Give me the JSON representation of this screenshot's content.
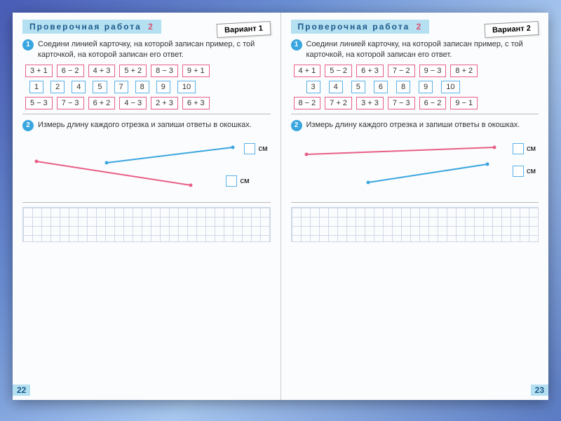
{
  "left": {
    "title": "Проверочная  работа",
    "title_num": "2",
    "variant": "Вариант 1",
    "task1_num": "1",
    "task1_text": "Соедини линией карточку, на которой записан пример, с той карточкой, на которой записан его ответ.",
    "row1": [
      "3 + 1",
      "6 − 2",
      "4 + 3",
      "5 + 2",
      "8 − 3",
      "9 + 1"
    ],
    "row2": [
      "1",
      "2",
      "4",
      "5",
      "7",
      "8",
      "9",
      "10"
    ],
    "row3": [
      "5 − 3",
      "7 − 3",
      "6 + 2",
      "4 − 3",
      "2 + 3",
      "6 + 3"
    ],
    "task2_num": "2",
    "task2_text": "Измерь длину каждого отрезка и запиши ответы в окошках.",
    "cm": "см",
    "pagenum": "22"
  },
  "right": {
    "title": "Проверочная  работа",
    "title_num": "2",
    "variant": "Вариант 2",
    "task1_num": "1",
    "task1_text": "Соедини линией карточку, на которой записан пример, с той карточкой, на которой записан его ответ.",
    "row1": [
      "4 + 1",
      "5 − 2",
      "6 + 3",
      "7 − 2",
      "9 − 3",
      "8 + 2"
    ],
    "row2": [
      "3",
      "4",
      "5",
      "6",
      "8",
      "9",
      "10"
    ],
    "row3": [
      "8 − 2",
      "7 + 2",
      "3 + 3",
      "7 − 3",
      "6 − 2",
      "9 − 1"
    ],
    "task2_num": "2",
    "task2_text": "Измерь длину каждого отрезка и запиши ответы в окошках.",
    "cm": "см",
    "pagenum": "23"
  }
}
